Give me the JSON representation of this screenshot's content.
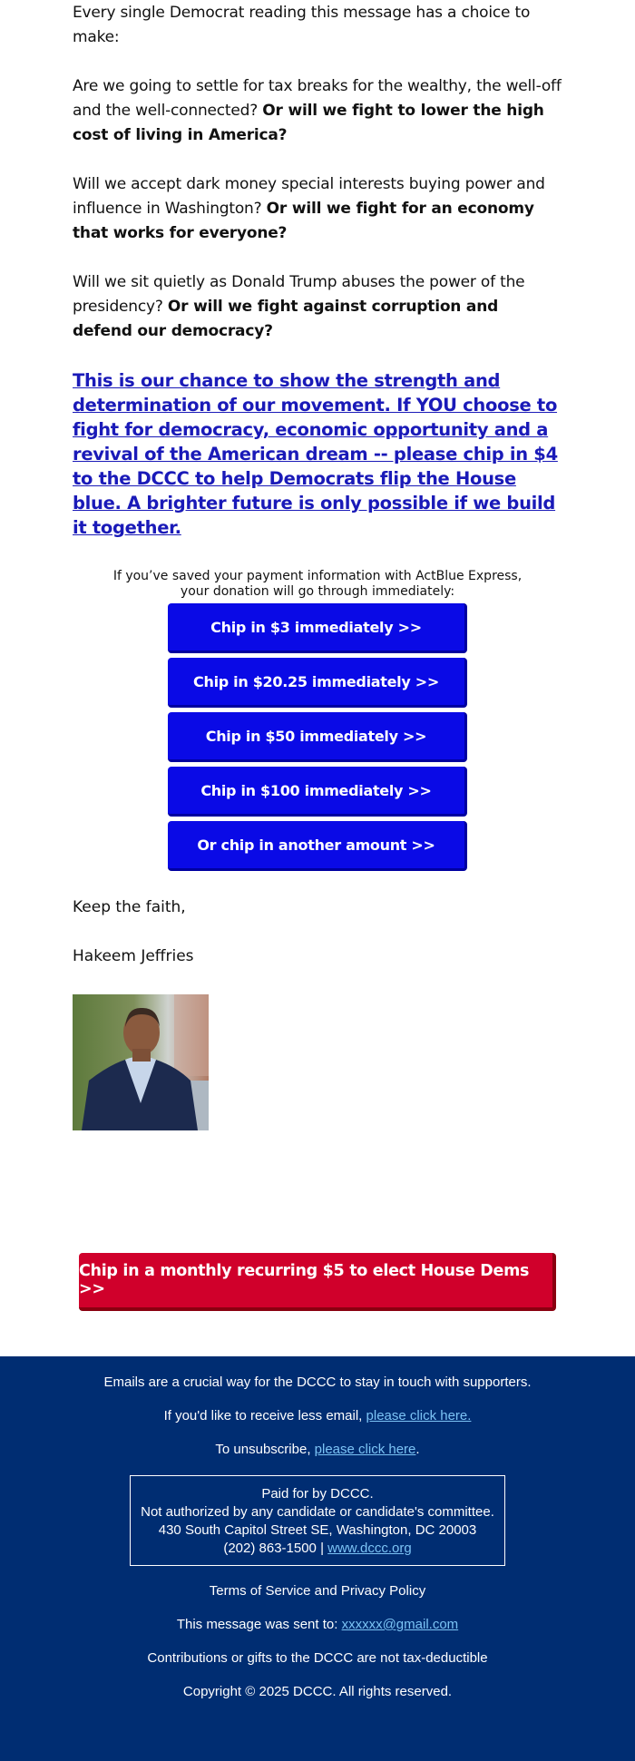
{
  "body": {
    "intro": "Every single Democrat reading this message has a choice to make:",
    "paragraphs": [
      {
        "regular": "Are we going to settle for tax breaks for the wealthy, the well-off and the well-connected?",
        "bold": "Or will we fight to lower the high cost of living in America?"
      },
      {
        "regular": "Will we accept dark money special interests buying power and influence in Washington?",
        "bold": "Or will we fight for an economy that works for everyone?"
      },
      {
        "regular": "Will we sit quietly as Donald Trump abuses the power of the presidency?",
        "bold": "Or will we fight against corruption and defend our democracy?"
      }
    ],
    "cta_link": "This is our chance to show the strength and determination of our movement. If YOU choose to fight for democracy, economic opportunity and a revival of the American dream -- please chip in $4 to the DCCC to help Democrats flip the House blue. A brighter future is only possible if we build it together."
  },
  "donation": {
    "express_note_line1": "If you’ve saved your payment information with ActBlue Express,",
    "express_note_line2": "your donation will go through immediately:",
    "buttons": [
      {
        "label": "Chip in $3 immediately >>"
      },
      {
        "label": "Chip in $20.25 immediately >>"
      },
      {
        "label": "Chip in $50 immediately >>"
      },
      {
        "label": "Chip in $100 immediately >>"
      },
      {
        "label": "Or chip in another amount >>"
      }
    ],
    "button_color": "#0a0ae6"
  },
  "signoff": {
    "closing": "Keep the faith,",
    "name": "Hakeem Jeffries",
    "photo_alt": "Photo of Hakeem Jeffries"
  },
  "recurring": {
    "label": "Chip in a monthly recurring $5 to elect House Dems >>",
    "color": "#d0002b"
  },
  "footer": {
    "bg_color": "#002d72",
    "line1": "Emails are a crucial way for the DCCC to stay in touch with supporters.",
    "less_email_prefix": "If you'd like to receive less email, ",
    "less_email_link": "please click here.",
    "unsubscribe_prefix": "To unsubscribe, ",
    "unsubscribe_link": "please click here",
    "unsubscribe_suffix": ".",
    "paid_for": "Paid for by DCCC.",
    "not_authorized": "Not authorized by any candidate or candidate's committee.",
    "address": "430 South Capitol Street SE, Washington, DC 20003",
    "phone": "(202) 863-1500 | ",
    "website": "www.dccc.org",
    "terms": "Terms of Service and Privacy Policy",
    "sent_to_prefix": "This message was sent to: ",
    "sent_to_email": "xxxxxx@gmail.com",
    "tax_note": "Contributions or gifts to the DCCC are not tax-deductible",
    "copyright": "Copyright © 2025 DCCC. All rights reserved."
  }
}
